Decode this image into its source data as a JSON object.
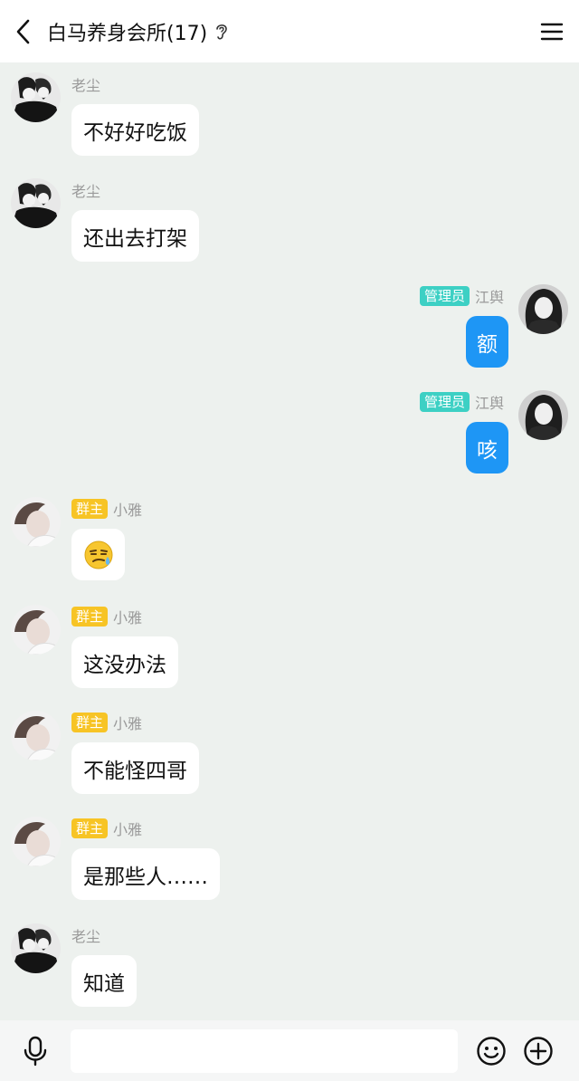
{
  "header": {
    "title": "白马养身会所(17)",
    "back_icon": "chevron-left-icon",
    "ear_icon": "ear-icon",
    "menu_icon": "hamburger-menu-icon"
  },
  "messages": [
    {
      "side": "left",
      "sender": "老尘",
      "badge": "",
      "text": "不好好吃饭"
    },
    {
      "side": "left",
      "sender": "老尘",
      "badge": "",
      "text": "还出去打架"
    },
    {
      "side": "right",
      "sender": "江舆",
      "badge": "管理员",
      "text": "额"
    },
    {
      "side": "right",
      "sender": "江舆",
      "badge": "管理员",
      "text": "咳"
    },
    {
      "side": "left",
      "sender": "小雅",
      "badge": "群主",
      "text": "",
      "sticker": "sweat-smirk-emoji"
    },
    {
      "side": "left",
      "sender": "小雅",
      "badge": "群主",
      "text": "这没办法"
    },
    {
      "side": "left",
      "sender": "小雅",
      "badge": "群主",
      "text": "不能怪四哥"
    },
    {
      "side": "left",
      "sender": "小雅",
      "badge": "群主",
      "text": "是那些人……"
    },
    {
      "side": "left",
      "sender": "老尘",
      "badge": "",
      "text": "知道"
    }
  ],
  "composer": {
    "mic_icon": "microphone-icon",
    "input_value": "",
    "emoji_icon": "smiley-icon",
    "plus_icon": "plus-circle-icon"
  },
  "colors": {
    "chat_bg": "#edf1ee",
    "my_bubble": "#1e96f5",
    "owner_badge": "#f7c425",
    "admin_badge": "#3dd0c4"
  }
}
